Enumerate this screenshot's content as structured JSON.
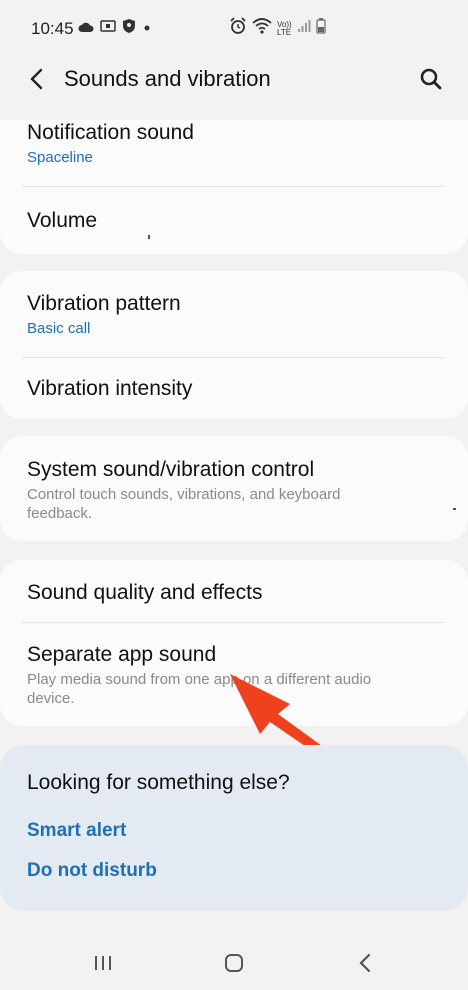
{
  "status_bar": {
    "time": "10:45",
    "icons_left": [
      "cloud-icon",
      "nfc-icon",
      "shield-icon",
      "dot-icon"
    ],
    "icons_right": [
      "alarm-icon",
      "wifi-icon",
      "volte-icon",
      "signal-icon",
      "battery-icon"
    ],
    "volte_label": "Vo)) LTE"
  },
  "header": {
    "title": "Sounds and vibration"
  },
  "cards": {
    "c1": {
      "notification_title": "Notification sound",
      "notification_value": "Spaceline",
      "volume_title": "Volume"
    },
    "c2": {
      "pattern_title": "Vibration pattern",
      "pattern_value": "Basic call",
      "intensity_title": "Vibration intensity"
    },
    "c3": {
      "system_title": "System sound/vibration control",
      "system_desc": "Control touch sounds, vibrations, and keyboard feedback."
    },
    "c4": {
      "quality_title": "Sound quality and effects",
      "separate_title": "Separate app sound",
      "separate_desc": "Play media sound from one app on a different audio device."
    }
  },
  "help": {
    "title": "Looking for something else?",
    "link1": "Smart alert",
    "link2": "Do not disturb"
  },
  "colors": {
    "accent": "#1d6fb8",
    "arrow": "#f0411f",
    "help_bg": "#e4eaf2"
  },
  "nav": [
    "recents-icon",
    "home-icon",
    "back-icon"
  ]
}
